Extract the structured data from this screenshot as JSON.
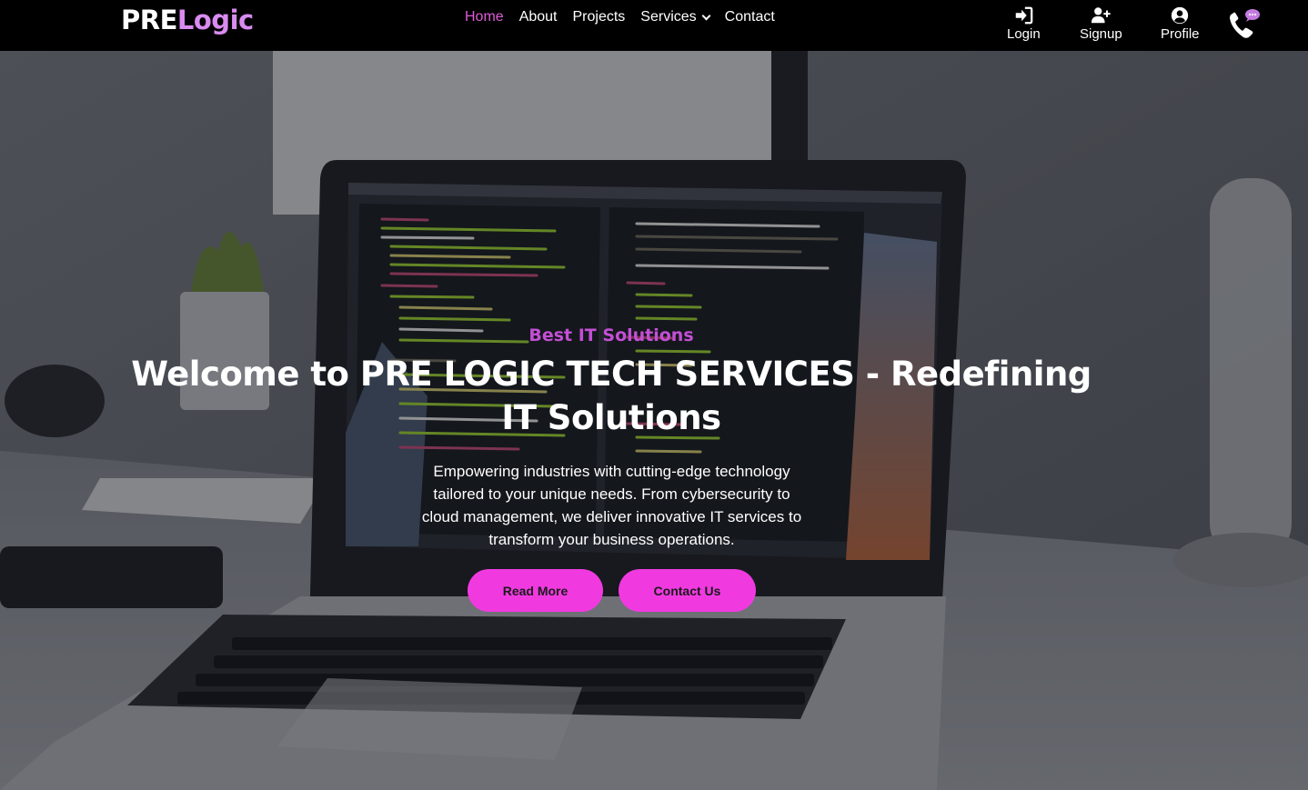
{
  "navbar": {
    "logo_pre": "PRE",
    "logo_logic": "Logic",
    "links": [
      {
        "label": "Home",
        "active": true
      },
      {
        "label": "About"
      },
      {
        "label": "Projects"
      },
      {
        "label": "Services",
        "dropdown": true
      },
      {
        "label": "Contact"
      }
    ],
    "actions": {
      "login": {
        "label": "Login",
        "icon": "login-icon"
      },
      "signup": {
        "label": "Signup",
        "icon": "add-user-icon"
      },
      "profile": {
        "label": "Profile",
        "icon": "user-circle-icon"
      }
    },
    "phone_icon": "phone-chat-icon"
  },
  "hero": {
    "tagline": "Best IT Solutions",
    "headline": "Welcome to PRE LOGIC TECH SERVICES - Redefining IT Solutions",
    "description": "Empowering industries with cutting-edge technology tailored to your unique needs. From cybersecurity to cloud management, we deliver innovative IT services to transform your business operations.",
    "buttons": {
      "read_more": "Read More",
      "contact_us": "Contact Us"
    }
  },
  "colors": {
    "accent": "#f03ae0",
    "active_link": "#e05ad8",
    "logo_accent": "#d98bf0",
    "navbar_bg": "#000000"
  }
}
